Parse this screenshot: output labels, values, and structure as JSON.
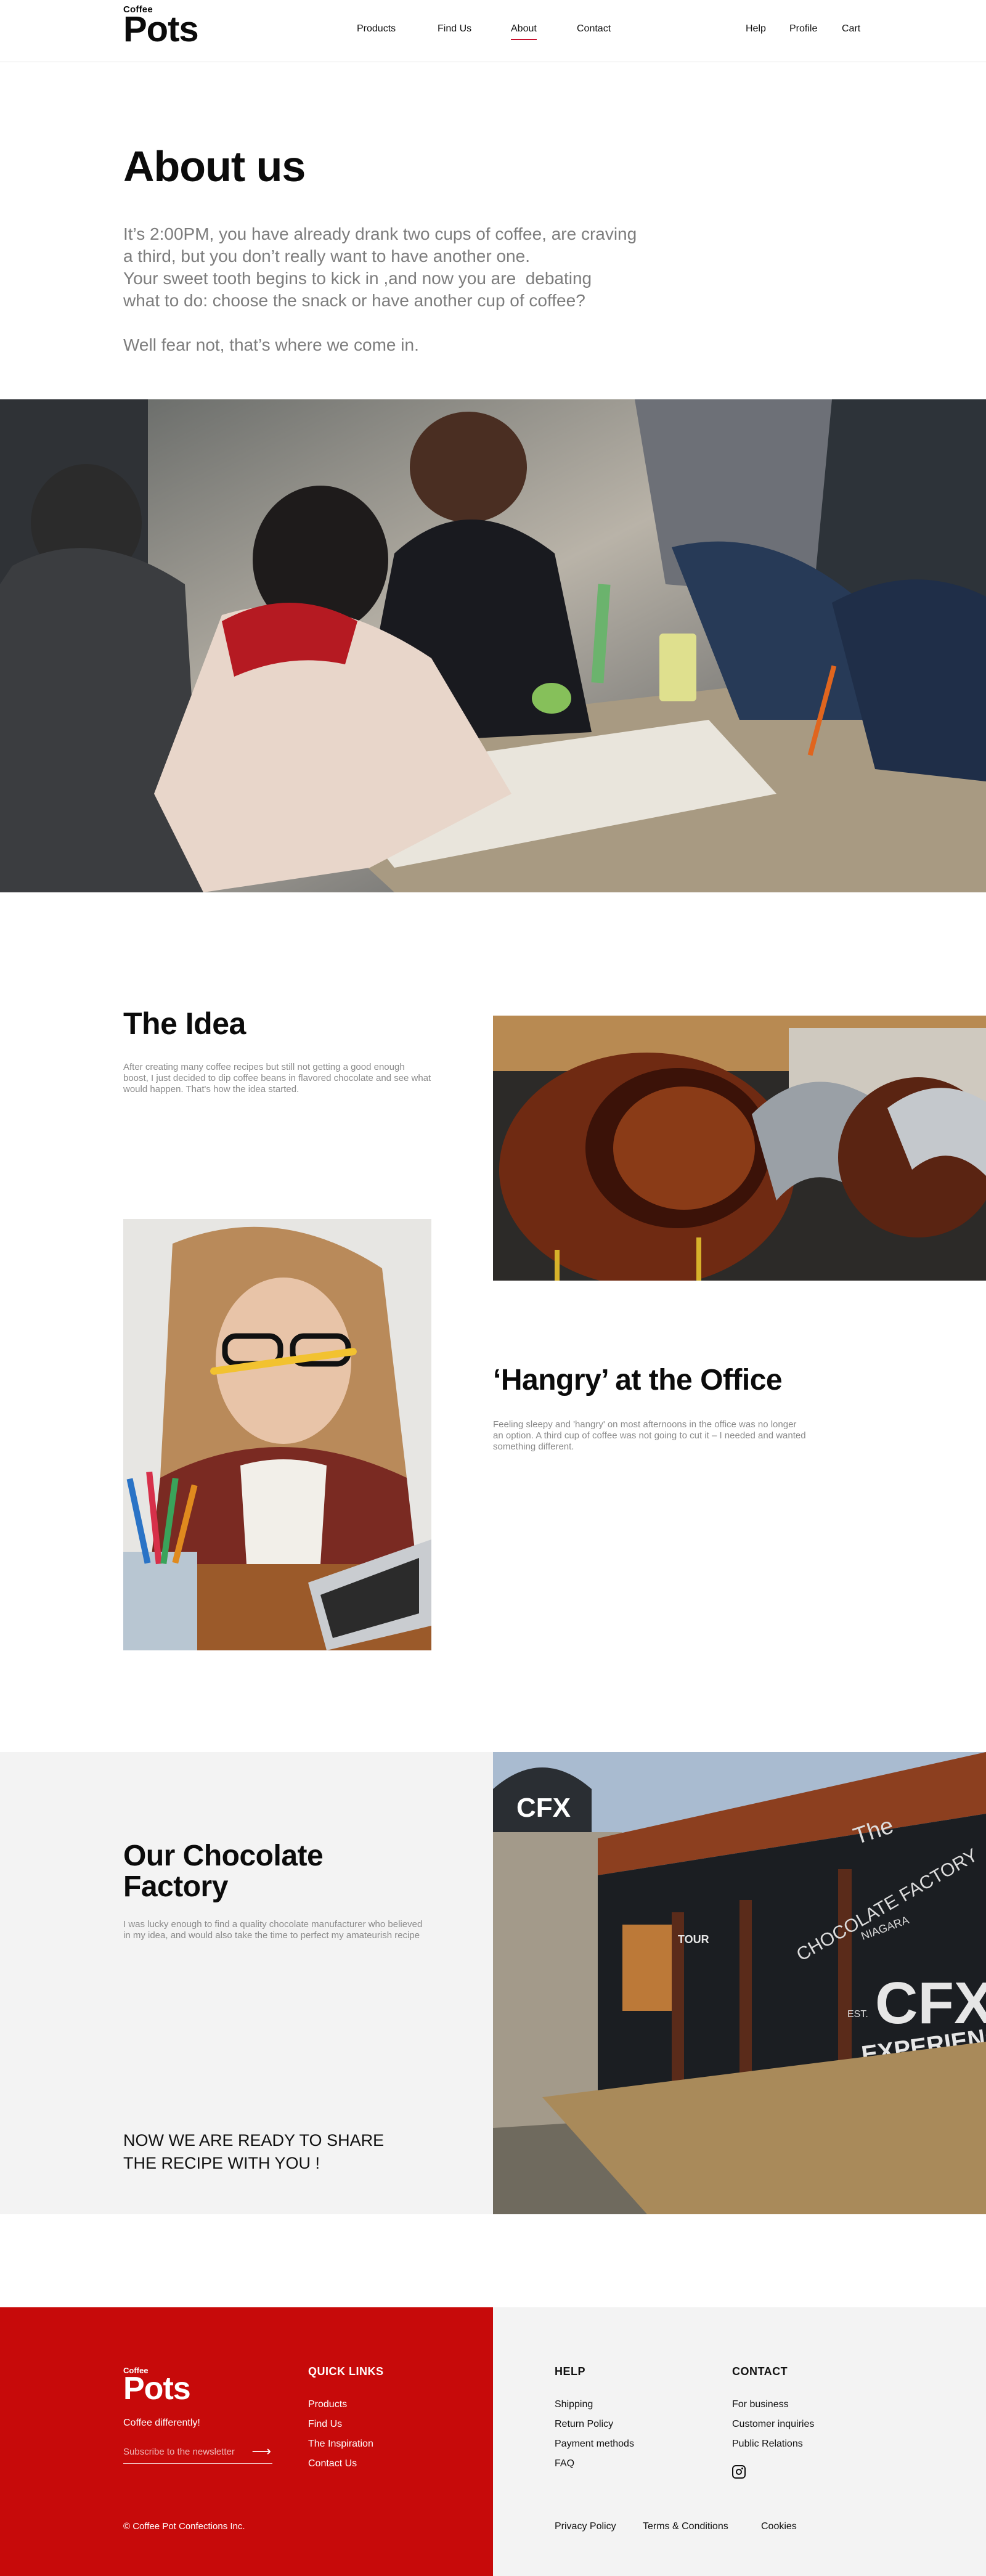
{
  "header": {
    "logo_small": "Coffee",
    "logo_big": "Pots",
    "nav": [
      "Products",
      "Find Us",
      "About",
      "Contact"
    ],
    "active_nav": "About",
    "utility": [
      "Help",
      "Profile",
      "Cart"
    ]
  },
  "about": {
    "title": "About us",
    "paragraph_lines": [
      "It’s 2:00PM, you have already drank two cups of coffee, are craving",
      "a third, but you don’t really want to have another one.",
      "Your sweet tooth begins to kick in ,and now you are  debating",
      "what to do: choose the snack or have another cup of coffee?"
    ],
    "closing": "Well fear not, that’s where we come in."
  },
  "idea": {
    "title": "The Idea",
    "text": "After creating many coffee recipes but still not getting a good enough boost, I just decided to dip coffee beans in flavored chocolate and see what would happen. That's how the idea started."
  },
  "hangry": {
    "title": "‘Hangry’ at the Office",
    "text": "Feeling sleepy and 'hangry' on most afternoons in the office was no longer an option. A third cup of coffee was not going to cut it – I needed and wanted something different."
  },
  "factory": {
    "title_line1": "Our Chocolate",
    "title_line2": "Factory",
    "text": "I was lucky enough to find a quality chocolate manufacturer who believed in my idea, and would also take the time to perfect my amateurish recipe",
    "ready": "NOW WE ARE READY TO SHARE THE RECIPE WITH YOU !",
    "sign_badge": "CFX",
    "sign_the": "The",
    "sign_factory": "CHOCOLATE FACTORY",
    "sign_niagara": "NIAGARA",
    "sign_est": "EST.",
    "sign_experience": "EXPERIENCE",
    "sign_door": "TOUR"
  },
  "footer": {
    "logo_small": "Coffee",
    "logo_big": "Pots",
    "tagline": "Coffee differently!",
    "subscribe_placeholder": "Subscribe to the newsletter",
    "arrow": "⟶",
    "quick_links_title": "QUICK LINKS",
    "quick_links": [
      "Products",
      "Find Us",
      "The Inspiration",
      "Contact Us"
    ],
    "help_title": "HELP",
    "help_links": [
      "Shipping",
      "Return Policy",
      "Payment methods",
      "FAQ"
    ],
    "contact_title": "CONTACT",
    "contact_links": [
      "For business",
      "Customer inquiries",
      "Public Relations"
    ],
    "copyright": "© Coffee Pot Confections Inc.",
    "legal": [
      "Privacy Policy",
      "Terms & Conditions",
      "Cookies"
    ]
  },
  "colors": {
    "brand_red": "#c70a0a",
    "nav_underline": "#c8102e",
    "light_gray": "#f3f3f3",
    "muted_text": "#8a8a8a"
  },
  "icons": [
    "instagram-icon",
    "arrow-right-icon"
  ]
}
